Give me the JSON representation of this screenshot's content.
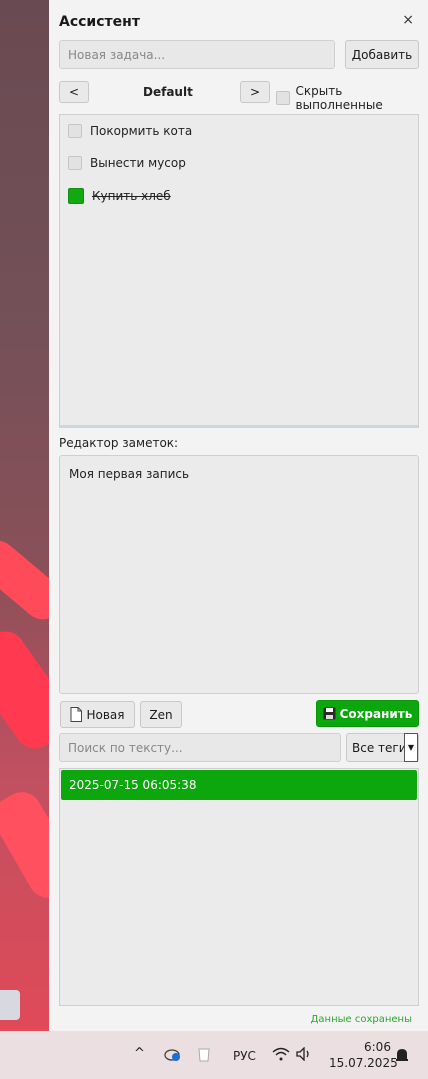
{
  "app": {
    "title": "Ассистент",
    "close_label": "×"
  },
  "task_input": {
    "placeholder": "Новая задача...",
    "add_label": "Добавить"
  },
  "list_nav": {
    "prev_label": "<",
    "list_name": "Default",
    "next_label": ">",
    "hide_completed_label": "Скрыть выполненные"
  },
  "tasks": [
    {
      "label": "Покормить кота",
      "done": false
    },
    {
      "label": "Вынести мусор",
      "done": false
    },
    {
      "label": "Купить хлеб",
      "done": true
    }
  ],
  "notes_editor": {
    "heading": "Редактор заметок:",
    "content": "Моя первая запись",
    "new_label": "Новая",
    "zen_label": "Zen",
    "save_label": "Сохранить",
    "search_placeholder": "Поиск по тексту...",
    "tag_filter_value": "Все теги"
  },
  "notes": [
    {
      "title": "2025-07-15 06:05:38"
    }
  ],
  "status": {
    "text": "Данные сохранены"
  },
  "taskbar": {
    "language": "РУС",
    "time": "6:06",
    "date": "15.07.2025"
  },
  "colors": {
    "accent_green": "#0ca70c",
    "status_green": "#2aa82a"
  }
}
